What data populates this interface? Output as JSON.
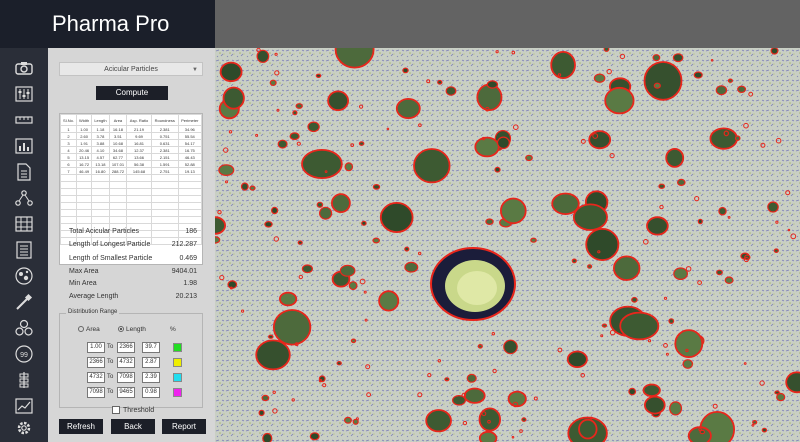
{
  "app": {
    "title": "Pharma Pro"
  },
  "toolbar": {
    "icons": [
      "camera-icon",
      "adjust-sliders-icon",
      "ruler-icon",
      "bar-chart-icon",
      "document-icon",
      "network-icon",
      "grid-icon",
      "list-icon",
      "particles-icon",
      "pipette-icon",
      "cells-icon",
      "count-icon",
      "stack-icon",
      "line-chart-icon",
      "gear-icon"
    ]
  },
  "panel": {
    "analysis_select": "Acicular Particles",
    "compute_label": "Compute",
    "table": {
      "headers": [
        "Sl.No.",
        "Width",
        "Length",
        "Area",
        "Asp. Ratio",
        "Roundness",
        "Perimeter"
      ],
      "rows": [
        [
          "1",
          "1.00",
          "1.18",
          "16.18",
          "21.19",
          "2.381",
          "34.96"
        ],
        [
          "2",
          "2.60",
          "3.78",
          "3.51",
          "9.69",
          "0.751",
          "55.54"
        ],
        [
          "3",
          "1.91",
          "3.88",
          "10.68",
          "16.81",
          "0.631",
          "54.17"
        ],
        [
          "4",
          "20.46",
          "4.10",
          "34.68",
          "12.37",
          "2.381",
          "16.75"
        ],
        [
          "5",
          "13.15",
          "4.57",
          "62.77",
          "13.66",
          "2.151",
          "46.43"
        ],
        [
          "6",
          "16.72",
          "13.18",
          "107.01",
          "56.38",
          "1.591",
          "52.88"
        ],
        [
          "7",
          "46.49",
          "16.80",
          "288.72",
          "145.68",
          "2.751",
          "19.13"
        ]
      ]
    },
    "stats": [
      {
        "label": "Total Acicular Particles",
        "value": "186"
      },
      {
        "label": "Length of Longest Particle",
        "value": "212.287"
      },
      {
        "label": "Length of Smallest Particle",
        "value": "0.469"
      },
      {
        "label": "Max Area",
        "value": "9404.01"
      },
      {
        "label": "Min Area",
        "value": "1.98"
      },
      {
        "label": "Average Length",
        "value": "20.213"
      }
    ],
    "distribution": {
      "title": "Distribution Range",
      "option_area": "Area",
      "option_length": "Length",
      "selected": "Length",
      "pct_header": "%",
      "to_label": "To",
      "rows": [
        {
          "from": "1.00",
          "to": "2366",
          "pct": "39.7",
          "color": "#22dd22"
        },
        {
          "from": "2366",
          "to": "4732",
          "pct": "2.87",
          "color": "#eeee00"
        },
        {
          "from": "4732",
          "to": "7098",
          "pct": "2.39",
          "color": "#22ddee"
        },
        {
          "from": "7098",
          "to": "9465",
          "pct": "0.98",
          "color": "#ee22ee"
        }
      ]
    },
    "threshold_label": "Threshold",
    "buttons": {
      "refresh": "Refresh",
      "back": "Back",
      "report": "Report"
    }
  },
  "image": {
    "background_color": "#c9cfc4",
    "outline_color": "#e8261c"
  }
}
